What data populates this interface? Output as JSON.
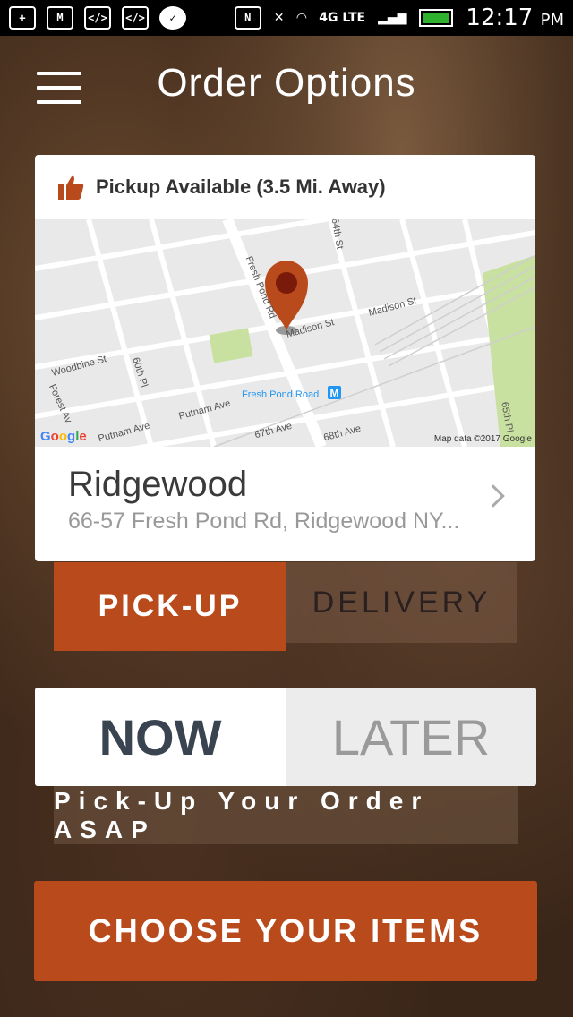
{
  "status_bar": {
    "icons": [
      "add-icon",
      "gmail-icon",
      "code-icon",
      "code-icon",
      "check-icon",
      "nfc-icon",
      "mute-icon",
      "wifi-icon",
      "4g-lte-icon",
      "signal-icon",
      "battery-icon"
    ],
    "network": "4G LTE",
    "time": "12:17",
    "meridiem": "PM"
  },
  "header": {
    "title": "Order Options"
  },
  "location_card": {
    "availability": "Pickup Available (3.5 Mi. Away)",
    "map": {
      "labels": [
        "64th St",
        "Fresh Pond Rd",
        "Madison St",
        "Madison St",
        "Woodbine St",
        "60th Pl",
        "Forest Av",
        "Putnam Ave",
        "Putnam Ave",
        "Fresh Pond Road",
        "67th Ave",
        "68th Ave",
        "65th Pl"
      ],
      "logo": "Google",
      "credit": "Map data ©2017 Google"
    },
    "name": "Ridgewood",
    "address": "66-57 Fresh Pond Rd, Ridgewood NY..."
  },
  "order_mode": {
    "pickup_label": "PICK-UP",
    "delivery_label": "DELIVERY",
    "selected": "PICK-UP"
  },
  "order_time": {
    "now_label": "NOW",
    "later_label": "LATER",
    "selected": "NOW",
    "note": "Pick-Up Your Order ASAP"
  },
  "cta": {
    "label": "CHOOSE YOUR ITEMS"
  },
  "colors": {
    "accent": "#b94a1c",
    "card": "#ffffff",
    "map_bg": "#e9e9e9",
    "park": "#c8e0a0",
    "transit": "#2196f3"
  }
}
